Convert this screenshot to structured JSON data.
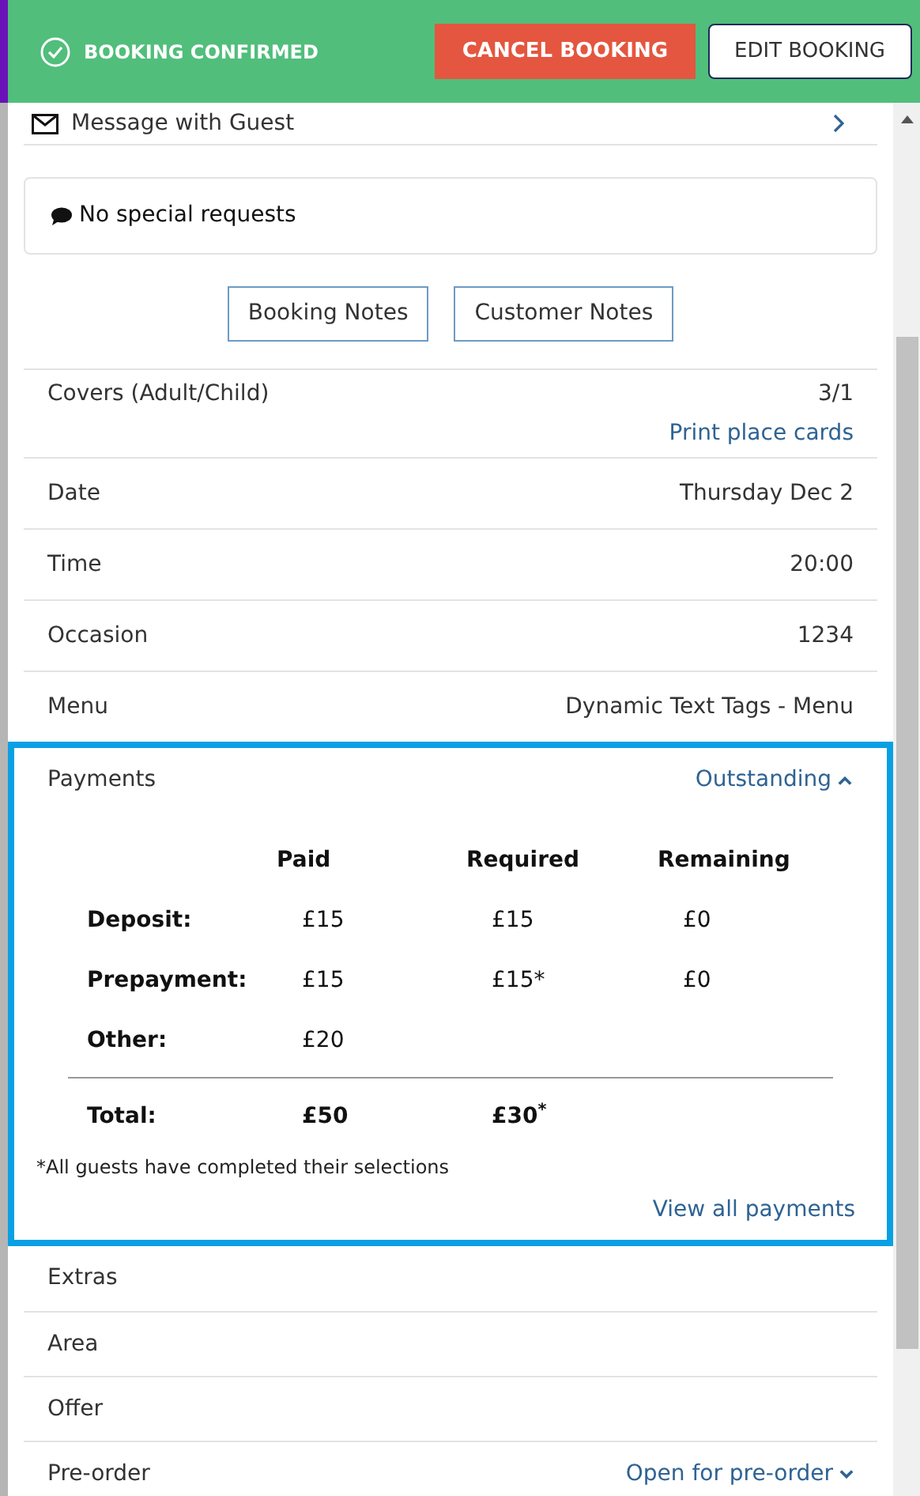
{
  "banner": {
    "status": "BOOKING CONFIRMED",
    "buttons": [
      {
        "kind": "danger",
        "label": "CANCEL BOOKING"
      },
      {
        "kind": "outline",
        "label": "EDIT BOOKING"
      }
    ]
  },
  "message_row": {
    "label": "Message with Guest"
  },
  "special_requests": "No special requests",
  "note_buttons": [
    "Booking Notes",
    "Customer Notes"
  ],
  "details": [
    {
      "label": "Covers (Adult/Child)",
      "value": "3/1",
      "link": "Print place cards"
    },
    {
      "label": "Date",
      "value": "Thursday Dec 2"
    },
    {
      "label": "Time",
      "value": "20:00"
    },
    {
      "label": "Occasion",
      "value": "1234"
    },
    {
      "label": "Menu",
      "value": "Dynamic Text Tags - Menu"
    }
  ],
  "payments": {
    "label": "Payments",
    "status": "Outstanding",
    "expanded": true,
    "highlighted": true,
    "columns": [
      "Paid",
      "Required",
      "Remaining"
    ],
    "rows": [
      {
        "label": "Deposit:",
        "cells": [
          "£15",
          "£15",
          "£0"
        ]
      },
      {
        "label": "Prepayment:",
        "cells": [
          "£15",
          "£15*",
          "£0"
        ]
      },
      {
        "label": "Other:",
        "cells": [
          "£20"
        ]
      }
    ],
    "total": {
      "label": "Total:",
      "cells": [
        "£50",
        "£30$^{*}$"
      ]
    },
    "footnote": "*All guests have completed their selections",
    "link": "View all payments"
  },
  "more_rows": [
    {
      "label": "Extras"
    },
    {
      "label": "Area"
    },
    {
      "label": "Offer"
    },
    {
      "label": "Pre-order",
      "value": "Open for pre-order",
      "expanded": false
    }
  ]
}
